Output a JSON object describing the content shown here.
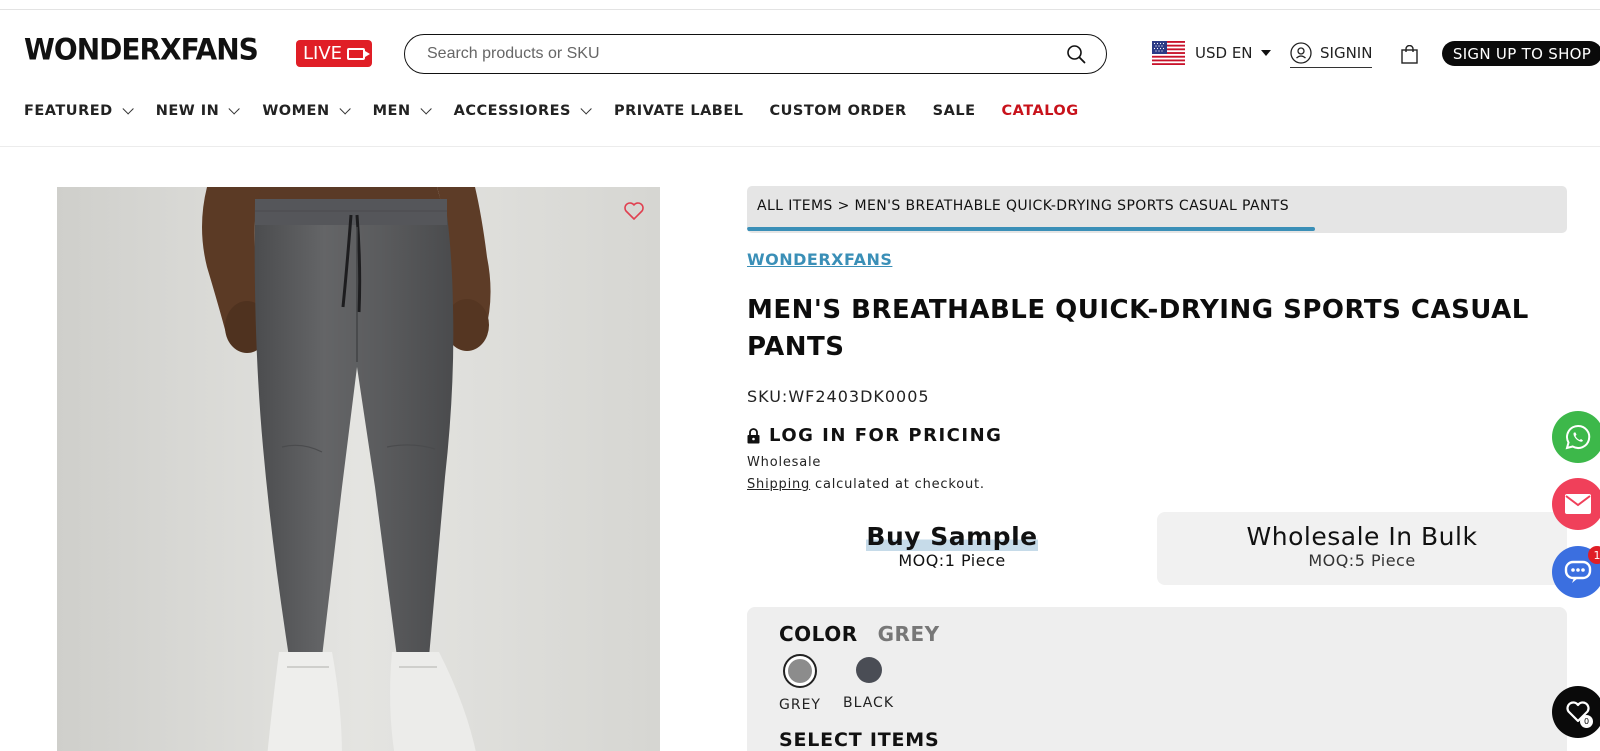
{
  "header": {
    "logo": "WONDERXFANS",
    "live_label": "LIVE",
    "search_placeholder": "Search products or SKU",
    "currency": "USD EN",
    "signin": "SIGNIN",
    "signup": "SIGN UP TO SHOP"
  },
  "nav": {
    "items": [
      {
        "label": "FEATURED"
      },
      {
        "label": "NEW IN"
      },
      {
        "label": "WOMEN"
      },
      {
        "label": "MEN"
      },
      {
        "label": "ACCESSIORES"
      },
      {
        "label": "PRIVATE LABEL"
      },
      {
        "label": "CUSTOM ORDER"
      },
      {
        "label": "SALE"
      },
      {
        "label": "CATALOG"
      }
    ]
  },
  "product": {
    "breadcrumb": "ALL ITEMS > MEN'S BREATHABLE QUICK-DRYING SPORTS CASUAL PANTS",
    "brand": "WONDERXFANS",
    "title": "MEN'S BREATHABLE QUICK-DRYING SPORTS CASUAL PANTS",
    "sku": "SKU:WF2403DK0005",
    "login_pricing": "LOG IN FOR PRICING",
    "wholesale": "Wholesale",
    "shipping_link": "Shipping",
    "shipping_rest": " calculated at checkout.",
    "options": {
      "sample_title": "Buy Sample",
      "sample_moq": "MOQ:1 Piece",
      "bulk_title": "Wholesale In Bulk",
      "bulk_moq": "MOQ:5 Piece"
    },
    "color_label": "COLOR",
    "color_value": "GREY",
    "swatches": [
      {
        "label": "GREY",
        "color": "#8c8c8c"
      },
      {
        "label": "BLACK",
        "color": "#4a4d55"
      }
    ],
    "select_items": "SELECT ITEMS"
  },
  "floating": {
    "chat_badge": "1",
    "wishlist_count": "0"
  },
  "colors": {
    "accent_blue": "#3a8fb7",
    "live_red": "#e01e26",
    "catalog_red": "#c8121b"
  }
}
